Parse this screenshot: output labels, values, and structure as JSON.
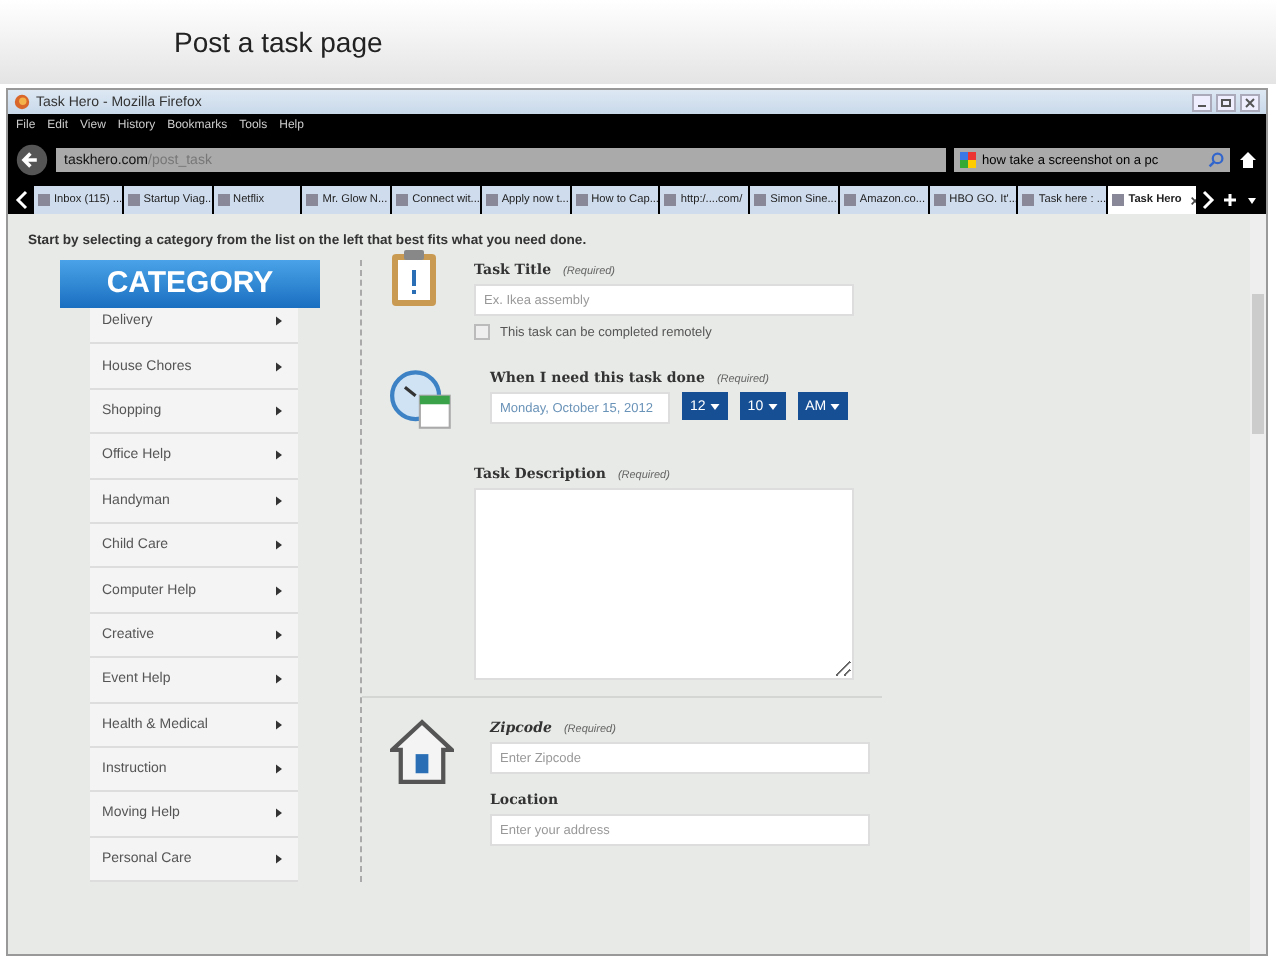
{
  "slide_title": "Post a task page",
  "window": {
    "title": "Task Hero - Mozilla Firefox"
  },
  "menu": [
    "File",
    "Edit",
    "View",
    "History",
    "Bookmarks",
    "Tools",
    "Help"
  ],
  "address_bar": {
    "domain": "taskhero.com",
    "path": "/post_task"
  },
  "search": {
    "value": "how take a screenshot on a pc"
  },
  "tabs": [
    {
      "label": "Inbox (115) ...",
      "selected": false
    },
    {
      "label": "Startup Viag...",
      "selected": false
    },
    {
      "label": "Netflix",
      "selected": false
    },
    {
      "label": "Mr. Glow N...",
      "selected": false
    },
    {
      "label": "Connect wit...",
      "selected": false
    },
    {
      "label": "Apply now t...",
      "selected": false
    },
    {
      "label": "How to Cap...",
      "selected": false
    },
    {
      "label": "http:/....com/",
      "selected": false
    },
    {
      "label": "Simon Sine...",
      "selected": false
    },
    {
      "label": "Amazon.co...",
      "selected": false
    },
    {
      "label": "HBO GO. It'...",
      "selected": false
    },
    {
      "label": "Task here : ...",
      "selected": false
    },
    {
      "label": "Task Hero",
      "selected": true
    }
  ],
  "intro": "Start by selecting a category from the list on the left that best fits what you need done.",
  "category": {
    "title": "CATEGORY",
    "items": [
      "Delivery",
      "House Chores",
      "Shopping",
      "Office Help",
      "Handyman",
      "Child Care",
      "Computer Help",
      "Creative",
      "Event Help",
      "Health & Medical",
      "Instruction",
      "Moving Help",
      "Personal Care"
    ]
  },
  "form": {
    "task_title": {
      "label": "Task Title",
      "required": "(Required)",
      "placeholder": "Ex. Ikea assembly"
    },
    "remote": {
      "label": "This task can be completed remotely",
      "checked": false
    },
    "when": {
      "label": "When I need this task done",
      "required": "(Required)",
      "date": "Monday, October 15, 2012",
      "hour": "12",
      "minute": "10",
      "ampm": "AM"
    },
    "description": {
      "label": "Task Description",
      "required": "(Required)"
    },
    "zipcode": {
      "label": "Zipcode",
      "required": "(Required)",
      "placeholder": "Enter Zipcode"
    },
    "location": {
      "label": "Location",
      "placeholder": "Enter your address"
    }
  }
}
